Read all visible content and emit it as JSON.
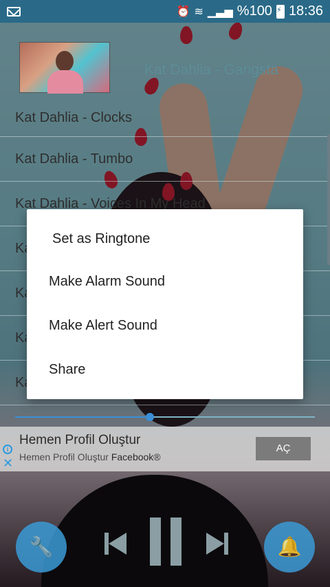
{
  "status_bar": {
    "battery_percent": "%100",
    "time": "18:36",
    "icons": [
      "message-icon",
      "alarm-icon",
      "wifi-icon",
      "signal-icon",
      "battery-charging-icon"
    ]
  },
  "now_playing": {
    "title": "Kat Dahlia - Gangsta"
  },
  "songs": [
    "Kat Dahlia - Clocks",
    "Kat Dahlia - Tumbo",
    "Kat Dahlia - Voices In My Head",
    "Ka",
    "Ka",
    "Ka",
    "Ka"
  ],
  "playback": {
    "progress": 0.45
  },
  "ad": {
    "headline": "Hemen Profil Oluştur",
    "sub_prefix": "Hemen Profil Oluştur ",
    "sub_brand": "Facebook®",
    "cta": "AÇ"
  },
  "context_menu": {
    "items": [
      "Set as Ringtone",
      "Make Alarm Sound",
      "Make Alert Sound",
      "Share"
    ]
  },
  "colors": {
    "status_bar": "#2a6a88",
    "accent": "#3b9ad6",
    "ad_button": "#7b7b7b"
  }
}
